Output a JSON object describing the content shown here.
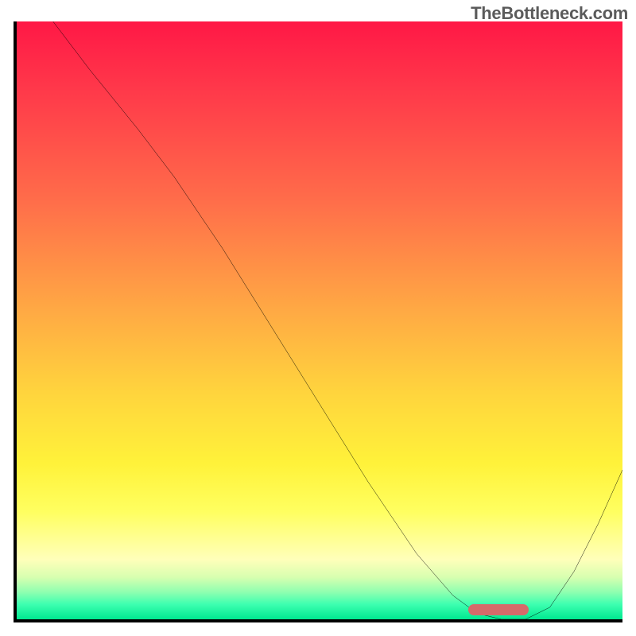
{
  "watermark": "TheBottleneck.com",
  "colors": {
    "gradient_top": "#ff1846",
    "gradient_mid1": "#ff6d4a",
    "gradient_mid2": "#ffd43d",
    "gradient_mid3": "#ffff60",
    "gradient_bottom": "#00e890",
    "curve": "#000000",
    "pill": "#d66a6a",
    "axis": "#000000",
    "watermark_text": "#5b5b5b"
  },
  "chart_data": {
    "type": "line",
    "title": "",
    "xlabel": "",
    "ylabel": "",
    "xlim": [
      0,
      100
    ],
    "ylim": [
      0,
      100
    ],
    "grid": false,
    "legend": false,
    "series": [
      {
        "name": "bottleneck-curve",
        "x": [
          6,
          12,
          20,
          26,
          34,
          42,
          50,
          58,
          66,
          72,
          76,
          80,
          84,
          88,
          92,
          96,
          100
        ],
        "y": [
          100,
          92,
          82,
          74,
          62,
          49,
          36,
          23,
          11,
          4,
          1,
          0,
          0,
          2,
          8,
          16,
          25
        ]
      }
    ],
    "marker": {
      "name": "optimal-range-pill",
      "x_start": 76,
      "x_end": 85,
      "y": 0.5,
      "color": "#d66a6a"
    },
    "notes": "x and y are percentage-of-plot coordinates; no numeric axis ticks or labels are shown in the source image, so values are read off geometrically."
  }
}
